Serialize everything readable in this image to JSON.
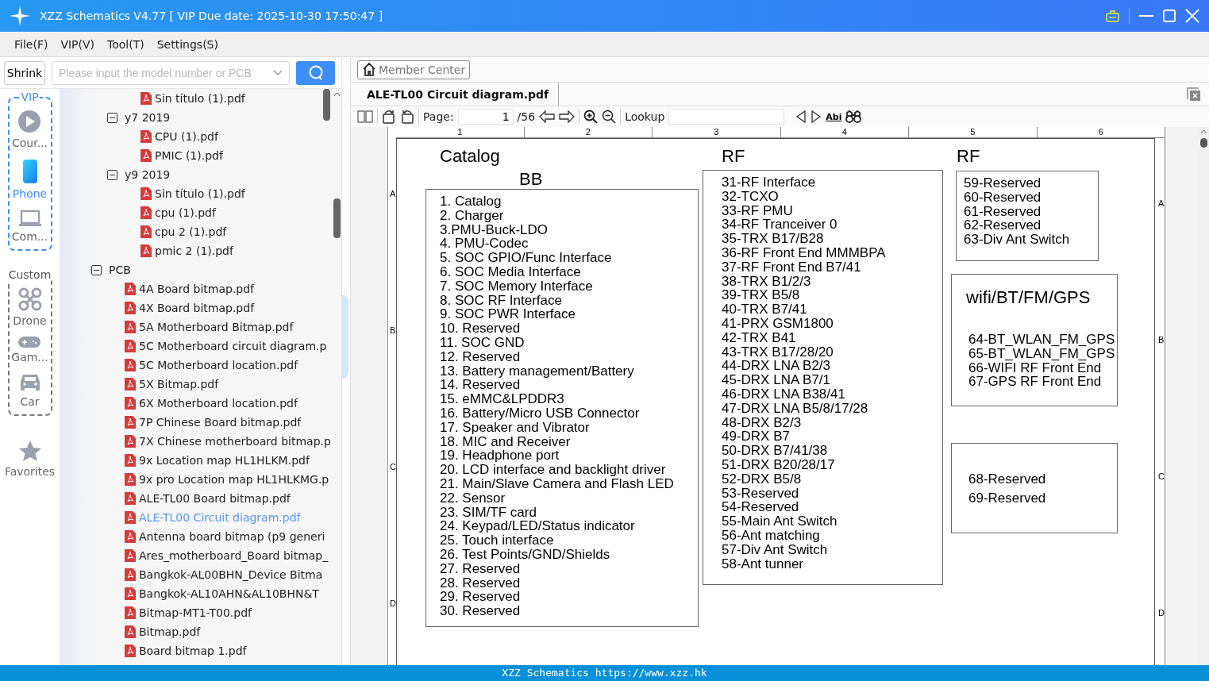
{
  "window": {
    "title": "XZZ Schematics V4.77 [ VIP Due date: 2025-10-30 17:50:47 ]"
  },
  "menu": [
    "File(F)",
    "VIP(V)",
    "Tool(T)",
    "Settings(S)"
  ],
  "search": {
    "shrink": "Shrink",
    "placeholder": "Please input the model number or PCB"
  },
  "nav": [
    {
      "label": "VIP",
      "kind": "vip",
      "items": [
        {
          "label": "Cour...",
          "kind": "play",
          "selected": false
        },
        {
          "label": "Phone",
          "kind": "phone",
          "selected": true
        },
        {
          "label": "Com...",
          "kind": "laptop",
          "selected": false
        }
      ]
    },
    {
      "label": "Custom",
      "kind": "custom",
      "items": [
        {
          "label": "Drone",
          "kind": "drone",
          "selected": false
        },
        {
          "label": "Gam...",
          "kind": "gamepad",
          "selected": false
        },
        {
          "label": "Car",
          "kind": "car",
          "selected": false
        }
      ]
    }
  ],
  "favorites": "Favorites",
  "tree": [
    {
      "children": [
        {
          "children": [
            {
              "kind": "file",
              "label": "Sin título (1).pdf",
              "selected": false
            }
          ]
        },
        {
          "kind": "folder",
          "label": "y7 2019",
          "expanded": true,
          "children": [
            {
              "kind": "file",
              "label": "CPU (1).pdf",
              "selected": false
            },
            {
              "kind": "file",
              "label": "PMIC (1).pdf",
              "selected": false
            }
          ]
        },
        {
          "kind": "folder",
          "label": "y9 2019",
          "expanded": true,
          "children": [
            {
              "kind": "file",
              "label": "Sin título (1).pdf",
              "selected": false
            },
            {
              "kind": "file",
              "label": "cpu (1).pdf",
              "selected": false
            },
            {
              "kind": "file",
              "label": "cpu 2 (1).pdf",
              "selected": false
            },
            {
              "kind": "file",
              "label": "pmic 2 (1).pdf",
              "selected": false
            }
          ]
        }
      ]
    },
    {
      "kind": "folder",
      "label": "PCB",
      "expanded": true,
      "children": [
        {
          "kind": "file",
          "label": "4A Board bitmap.pdf",
          "selected": false
        },
        {
          "kind": "file",
          "label": "4X Board bitmap.pdf",
          "selected": false
        },
        {
          "kind": "file",
          "label": "5A Motherboard Bitmap.pdf",
          "selected": false
        },
        {
          "kind": "file",
          "label": "5C Motherboard circuit diagram.p",
          "selected": false
        },
        {
          "kind": "file",
          "label": "5C Motherboard location.pdf",
          "selected": false
        },
        {
          "kind": "file",
          "label": "5X Bitmap.pdf",
          "selected": false
        },
        {
          "kind": "file",
          "label": "6X Motherboard location.pdf",
          "selected": false
        },
        {
          "kind": "file",
          "label": "7P Chinese Board bitmap.pdf",
          "selected": false
        },
        {
          "kind": "file",
          "label": "7X Chinese motherboard bitmap.p",
          "selected": false
        },
        {
          "kind": "file",
          "label": "9x Location map HL1HLKM.pdf",
          "selected": false
        },
        {
          "kind": "file",
          "label": "9x pro Location map HL1HLKMG.p",
          "selected": false
        },
        {
          "kind": "file",
          "label": "ALE-TL00 Board bitmap.pdf",
          "selected": false
        },
        {
          "kind": "file",
          "label": "ALE-TL00 Circuit diagram.pdf",
          "selected": true
        },
        {
          "kind": "file",
          "label": "Antenna board bitmap (p9 generi",
          "selected": false
        },
        {
          "kind": "file",
          "label": "Ares_motherboard_Board bitmap_",
          "selected": false
        },
        {
          "kind": "file",
          "label": "Bangkok-AL00BHN_Device Bitma",
          "selected": false
        },
        {
          "kind": "file",
          "label": "Bangkok-AL10AHN&AL10BHN&T",
          "selected": false
        },
        {
          "kind": "file",
          "label": "Bitmap-MT1-T00.pdf",
          "selected": false
        },
        {
          "kind": "file",
          "label": "Bitmap.pdf",
          "selected": false
        },
        {
          "kind": "file",
          "label": "Board bitmap 1.pdf",
          "selected": false
        }
      ]
    }
  ],
  "member_center": "Member Center",
  "tabs": [
    {
      "label": "ALE-TL00 Circuit diagram.pdf",
      "selected": true
    }
  ],
  "toolbar": {
    "page_label": "Page:",
    "page": "1",
    "page_count": "/56",
    "lookup_label": "Lookup",
    "match_label": "Abi"
  },
  "document": {
    "columns": [
      "1",
      "2",
      "3",
      "4",
      "5",
      "6"
    ],
    "rows_left": [
      "A",
      "B",
      "C",
      "D"
    ],
    "rows_right": [
      "A",
      "B",
      "C",
      "D"
    ],
    "catalog_title": "Catalog",
    "bb_title": "BB",
    "bb_items": [
      "1. Catalog",
      "2. Charger",
      "3.PMU-Buck-LDO",
      "4. PMU-Codec",
      "5. SOC GPIO/Func Interface",
      "6. SOC Media Interface",
      "7. SOC Memory Interface",
      "8. SOC RF Interface",
      "9. SOC PWR Interface",
      "10. Reserved",
      "11. SOC GND",
      "12. Reserved",
      "13. Battery management/Battery",
      "14. Reserved",
      "15. eMMC&LPDDR3",
      "16. Battery/Micro USB Connector",
      "17. Speaker and Vibrator",
      "18. MIC and Receiver",
      "19. Headphone port",
      "20. LCD interface and backlight driver",
      "21. Main/Slave Camera and Flash LED",
      "22. Sensor",
      "23. SIM/TF card",
      "24. Keypad/LED/Status indicator",
      "25. Touch interface",
      "26. Test Points/GND/Shields",
      "27. Reserved",
      "28. Reserved",
      "29. Reserved",
      "30. Reserved"
    ],
    "rf_title": "RF",
    "rf_items": [
      "31-RF Interface",
      "32-TCXO",
      "33-RF PMU",
      "34-RF Tranceiver 0",
      "35-TRX B17/B28",
      "36-RF Front End MMMBPA",
      "37-RF Front End B7/41",
      "38-TRX B1/2/3",
      "39-TRX B5/8",
      "40-TRX B7/41",
      "41-PRX GSM1800",
      "42-TRX B41",
      "43-TRX B17/28/20",
      "44-DRX LNA B2/3",
      "45-DRX LNA B7/1",
      "46-DRX LNA B38/41",
      "47-DRX LNA B5/8/17/28",
      "48-DRX B2/3",
      "49-DRX B7",
      "50-DRX B7/41/38",
      "51-DRX B20/28/17",
      "52-DRX B5/8",
      "53-Reserved",
      "54-Reserved",
      "55-Main Ant Switch",
      "56-Ant matching",
      "57-Div Ant Switch",
      "58-Ant tunner"
    ],
    "rf2_title": "RF",
    "rf2_items": [
      "59-Reserved",
      "60-Reserved",
      "61-Reserved",
      "62-Reserved",
      "63-Div Ant Switch"
    ],
    "wifi_title": "wifi/BT/FM/GPS",
    "wifi_items": [
      "64-BT_WLAN_FM_GPS",
      "65-BT_WLAN_FM_GPS",
      "66-WIFI RF Front End",
      "67-GPS RF Front End"
    ],
    "extra_items": [
      "68-Reserved",
      "69-Reserved"
    ]
  },
  "status_bar": "XZZ Schematics https://www.xzz.hk"
}
